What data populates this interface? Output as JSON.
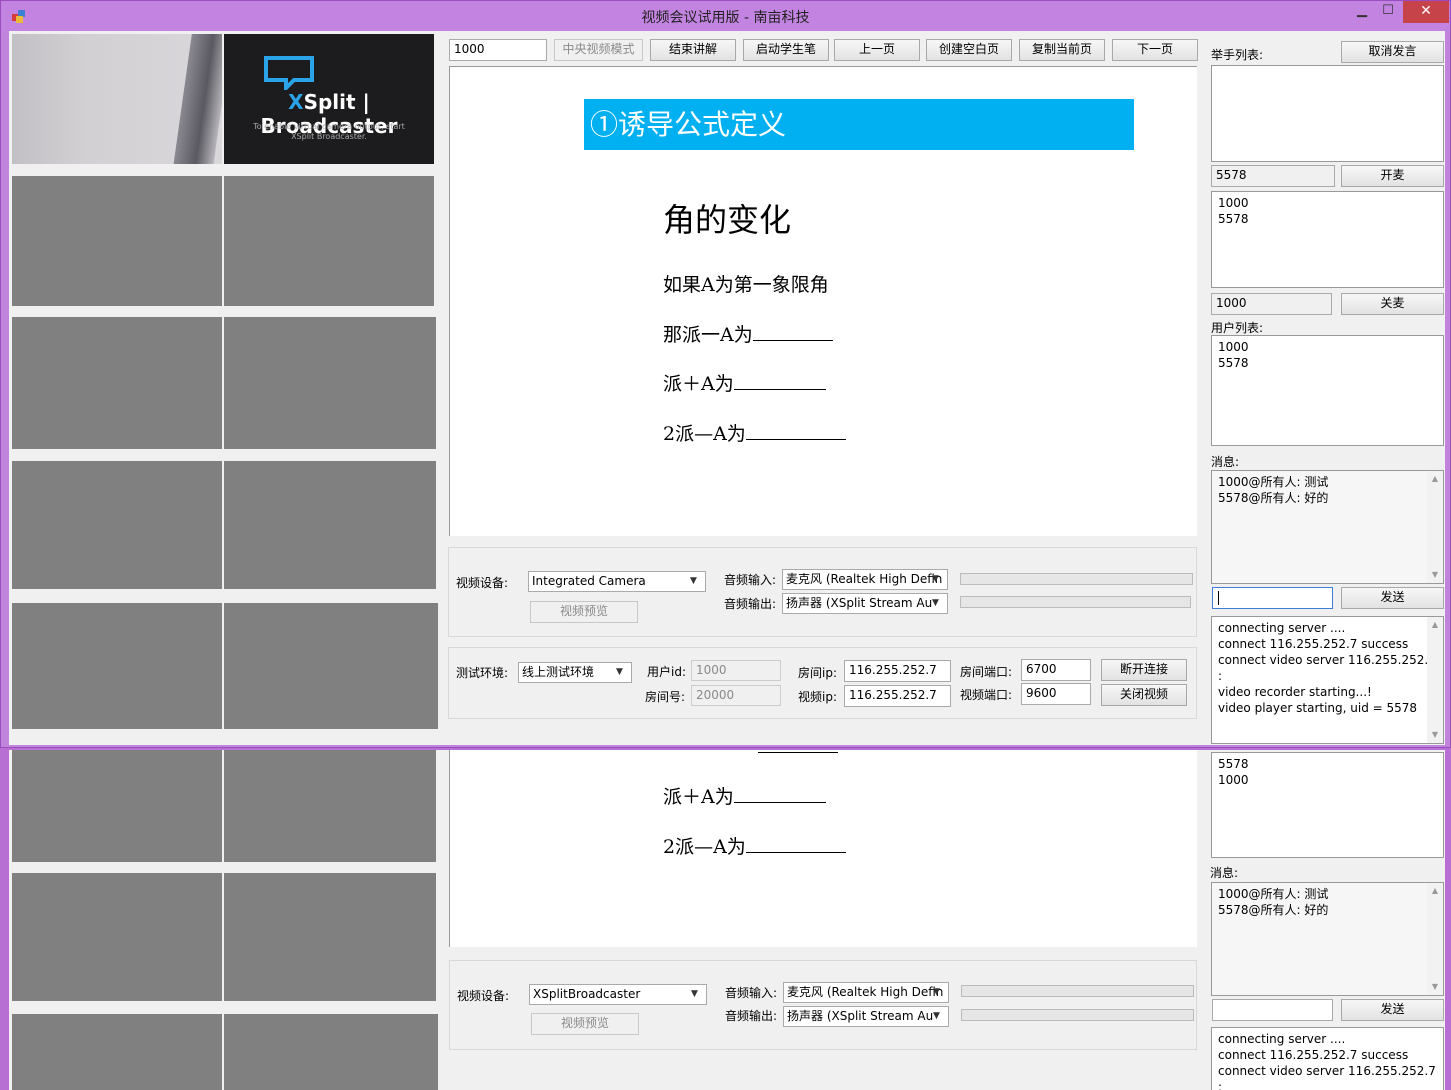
{
  "window": {
    "title": "视频会议试用版 - 南亩科技",
    "minimize": "▁",
    "maximize": "☐",
    "close": "✕"
  },
  "toolbar": {
    "user_input": "1000",
    "center_mode": "中央视频模式",
    "end_lecture": "结束讲解",
    "start_pen": "启动学生笔",
    "prev_page": "上一页",
    "new_blank": "创建空白页",
    "copy_page": "复制当前页",
    "next_page": "下一页"
  },
  "camera": {
    "xsplit_brand_x": "X",
    "xsplit_brand_rest": "Split | Broadcaster",
    "xsplit_note": "To enable virtual camera output, start XSplit Broadcaster."
  },
  "slide": {
    "banner": "①诱导公式定义",
    "heading": "角的变化",
    "line1": "如果A为第一象限角",
    "line2": "那派一A为",
    "line3": "派＋A为",
    "line4": "2派—A为"
  },
  "devices": {
    "video_label": "视频设备:",
    "video_value": "Integrated Camera",
    "preview": "视频预览",
    "audio_in_label": "音频输入:",
    "audio_in_value": "麦克风 (Realtek High Defin",
    "audio_out_label": "音频输出:",
    "audio_out_value": "扬声器 (XSplit  Stream  Au",
    "audio_in_level": 0,
    "audio_out_level": 0
  },
  "connection": {
    "env_label": "测试环境:",
    "env_value": "线上测试环境",
    "userid_label": "用户id:",
    "userid_value": "1000",
    "roomno_label": "房间号:",
    "roomno_value": "20000",
    "roomip_label": "房间ip:",
    "roomip_value": "116.255.252.7",
    "videoip_label": "视频ip:",
    "videoip_value": "116.255.252.7",
    "roomport_label": "房间端口:",
    "roomport_value": "6700",
    "videoport_label": "视频端口:",
    "videoport_value": "9600",
    "disconnect": "断开连接",
    "close_video": "关闭视频"
  },
  "right": {
    "hands_label": "举手列表:",
    "cancel_speak": "取消发言",
    "open_mic_input": "5578",
    "open_mic": "开麦",
    "mic_list": [
      "1000",
      "5578"
    ],
    "close_mic_input": "1000",
    "close_mic": "关麦",
    "users_label": "用户列表:",
    "users": [
      "1000",
      "5578"
    ],
    "msg_label": "消息:",
    "messages": [
      "1000@所有人: 测试",
      "5578@所有人: 好的"
    ],
    "chat_input": "",
    "send": "发送",
    "log": [
      "connecting server ....",
      "connect 116.255.252.7 success",
      "connect video server 116.255.252.7 :",
      "video recorder starting...!",
      "video player starting, uid = 5578"
    ]
  },
  "back_window": {
    "users": [
      "5578",
      "1000"
    ],
    "msg_label": "消息:",
    "messages": [
      "1000@所有人: 测试",
      "5578@所有人: 好的"
    ],
    "send": "发送",
    "video_label": "视频设备:",
    "video_value": "XSplitBroadcaster",
    "preview": "视频预览",
    "audio_in_label": "音频输入:",
    "audio_in_value": "麦克风 (Realtek High Defin",
    "audio_out_label": "音频输出:",
    "audio_out_value": "扬声器 (XSplit  Stream  Au",
    "slide_line3": "派＋A为",
    "slide_line4": "2派—A为",
    "log": [
      "connecting server ....",
      "connect 116.255.252.7 success",
      "connect video server 116.255.252.7 :"
    ]
  }
}
